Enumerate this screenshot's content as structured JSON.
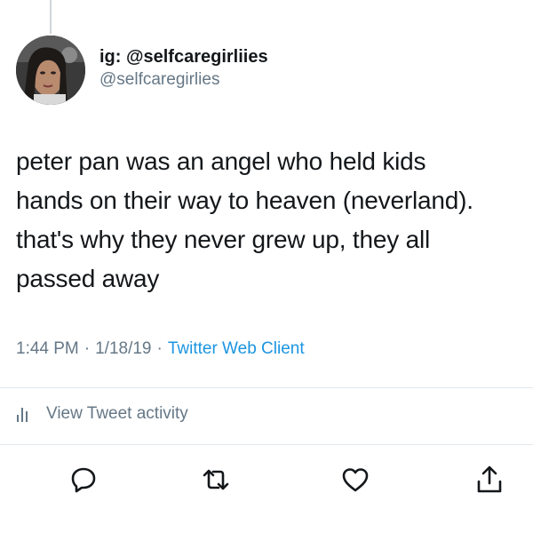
{
  "user": {
    "display_name": "ig: @selfcaregirliies",
    "handle": "@selfcaregirlies"
  },
  "tweet": {
    "lines": [
      "peter pan was an angel who held kids",
      "hands on their way to heaven (neverland).",
      "that's why they never grew up, they all",
      "passed away"
    ],
    "time": "1:44 PM",
    "date": "1/18/19",
    "source": "Twitter Web Client",
    "separator": "·"
  },
  "activity": {
    "label": "View Tweet activity"
  },
  "actions": {
    "icons": [
      "reply-icon",
      "retweet-icon",
      "like-icon",
      "share-icon"
    ]
  },
  "colors": {
    "text": "#14171a",
    "secondary": "#657786",
    "link": "#1b95e0",
    "divider": "#e1e8ed"
  }
}
